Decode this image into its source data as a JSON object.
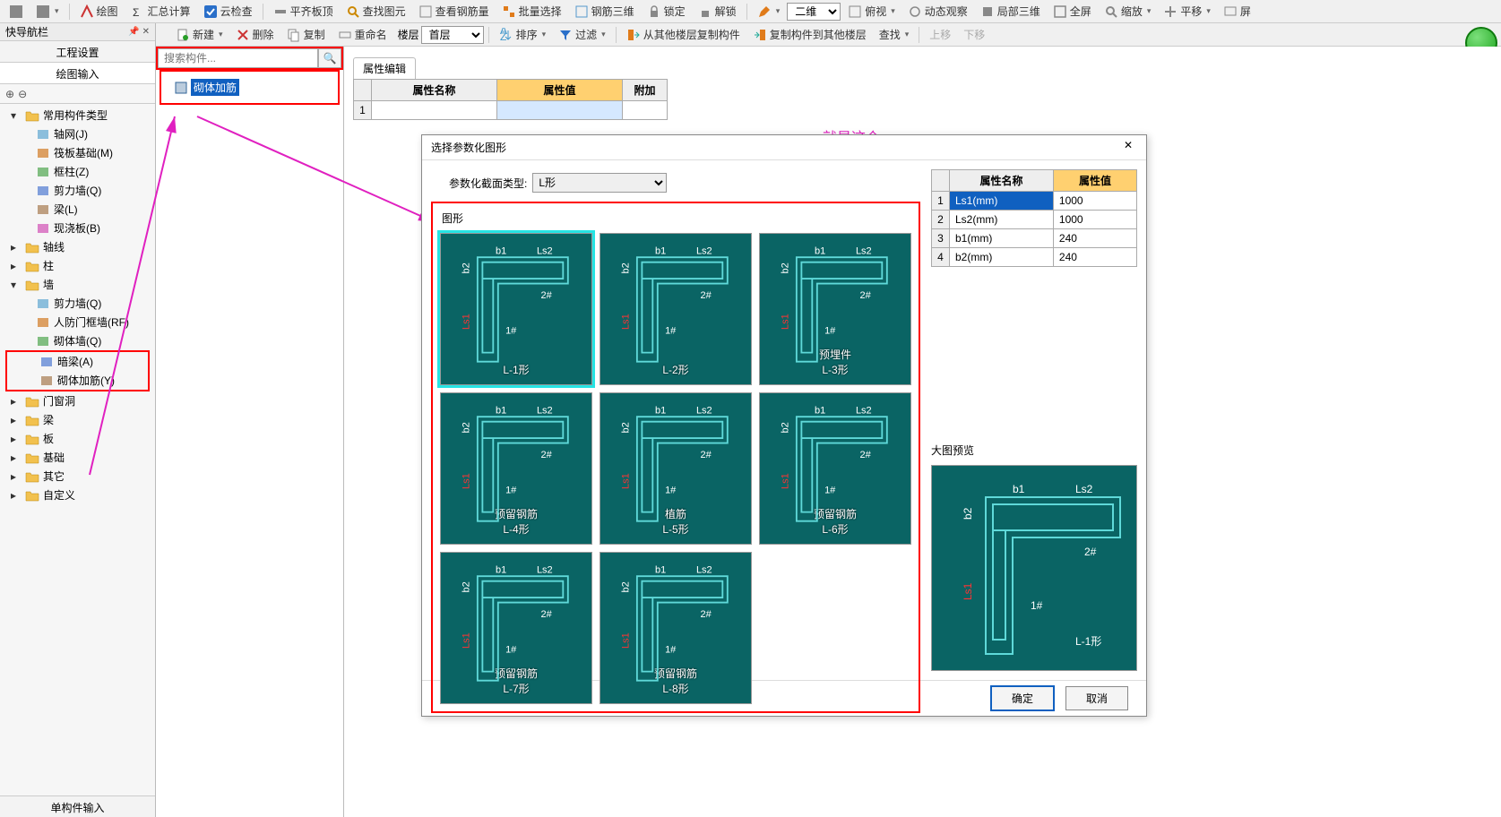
{
  "toolbar_top": {
    "draw": "绘图",
    "sum": "汇总计算",
    "cloud": "云检查",
    "flat": "平齐板顶",
    "find_elem": "查找图元",
    "view_rebar": "查看钢筋量",
    "batch_sel": "批量选择",
    "rebar3d": "钢筋三维",
    "lock": "锁定",
    "unlock": "解锁",
    "view_mode": "二维",
    "top_view": "俯视",
    "dyn_view": "动态观察",
    "local3d": "局部三维",
    "fullscreen": "全屏",
    "zoom": "缩放",
    "pan": "平移",
    "screen": "屏"
  },
  "toolbar_second": {
    "new": "新建",
    "delete": "删除",
    "copy": "复制",
    "rename": "重命名",
    "floor_label": "楼层",
    "floor_sel": "首层",
    "sort": "排序",
    "filter": "过滤",
    "copy_from": "从其他楼层复制构件",
    "copy_to": "复制构件到其他楼层",
    "findrep": "查找",
    "up": "上移",
    "down": "下移"
  },
  "left_panel": {
    "title": "快导航栏",
    "tab_engineering": "工程设置",
    "tab_draw_input": "绘图输入",
    "bottom_tab": "单构件输入"
  },
  "tree": {
    "common": "常用构件类型",
    "items_common": [
      {
        "t": "轴网(J)"
      },
      {
        "t": "筏板基础(M)"
      },
      {
        "t": "框柱(Z)"
      },
      {
        "t": "剪力墙(Q)"
      },
      {
        "t": "梁(L)"
      },
      {
        "t": "现浇板(B)"
      }
    ],
    "axis": "轴线",
    "column": "柱",
    "wall": "墙",
    "items_wall": [
      {
        "t": "剪力墙(Q)"
      },
      {
        "t": "人防门框墙(RF)"
      },
      {
        "t": "砌体墙(Q)"
      },
      {
        "t": "暗梁(A)"
      },
      {
        "t": "砌体加筋(Y)"
      }
    ],
    "door_win": "门窗洞",
    "beam": "梁",
    "slab": "板",
    "foundation": "基础",
    "other": "其它",
    "custom": "自定义"
  },
  "search": {
    "placeholder": "搜索构件..."
  },
  "component_item": "砌体加筋",
  "prop_panel": {
    "tab": "属性编辑",
    "col_name": "属性名称",
    "col_val": "属性值",
    "col_extra": "附加",
    "row_idx": "1"
  },
  "anno_text": "就是这个。",
  "dialog": {
    "title": "选择参数化图形",
    "section_label": "参数化截面类型:",
    "section_value": "L形",
    "shapes_label": "图形",
    "shapes": [
      "L-1形",
      "L-2形",
      "预埋件\nL-3形",
      "预留钢筋\nL-4形",
      "植筋\nL-5形",
      "预留钢筋\nL-6形",
      "预留钢筋\nL-7形",
      "预留钢筋\nL-8形"
    ],
    "param_hdr_name": "属性名称",
    "param_hdr_val": "属性值",
    "params": [
      {
        "i": "1",
        "n": "Ls1(mm)",
        "v": "1000"
      },
      {
        "i": "2",
        "n": "Ls2(mm)",
        "v": "1000"
      },
      {
        "i": "3",
        "n": "b1(mm)",
        "v": "240"
      },
      {
        "i": "4",
        "n": "b2(mm)",
        "v": "240"
      }
    ],
    "preview_label": "大图预览",
    "preview_caption": "L-1形",
    "ok": "确定",
    "cancel": "取消"
  }
}
